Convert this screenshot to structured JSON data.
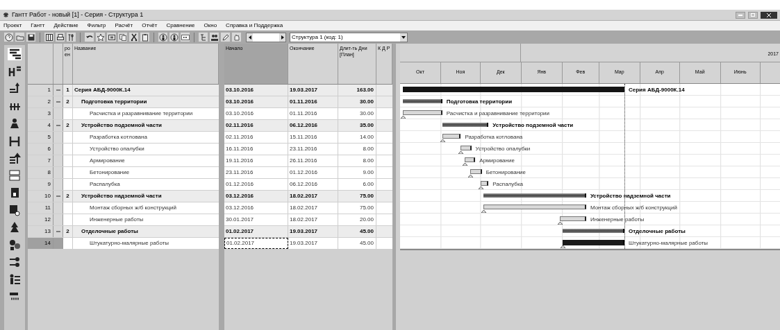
{
  "window": {
    "title": "Гантт Работ - новый [1] - Серия - Структура 1"
  },
  "menu": [
    "Проект",
    "Гантт",
    "Действие",
    "Фильтр",
    "Расчёт",
    "Отчёт",
    "Сравнение",
    "Окно",
    "Справка и Поддержка"
  ],
  "toolbar": {
    "structure_select": {
      "value": "Структура 1 (код: 1)"
    }
  },
  "table": {
    "columns": [
      {
        "label": "ро ен",
        "selected": false
      },
      {
        "label": "Название",
        "selected": false
      },
      {
        "label": "Начало",
        "selected": true
      },
      {
        "label": "Окончание",
        "selected": false
      },
      {
        "label": "Длит-ть Дни [План]",
        "selected": false
      },
      {
        "label": "К Д Р",
        "selected": false
      }
    ],
    "rows": [
      {
        "number": "1",
        "expanded": true,
        "level": "1",
        "name": "Серия АБД-9000К.14",
        "start": "03.10.2016",
        "end": "19.03.2017",
        "duration": "163.00",
        "kind": "root",
        "selected": false,
        "bar_label": "Серия АБД-9000К.14"
      },
      {
        "number": "2",
        "expanded": true,
        "level": "2",
        "name": "Подготовка территории",
        "start": "03.10.2016",
        "end": "01.11.2016",
        "duration": "30.00",
        "kind": "summary",
        "selected": false,
        "bar_label": "Подготовка территории"
      },
      {
        "number": "3",
        "name": "Расчистка и разравнивание территории",
        "start": "03.10.2016",
        "end": "01.11.2016",
        "duration": "30.00",
        "kind": "task",
        "selected": false,
        "bar_label": "Расчистка и разравнивание территории"
      },
      {
        "number": "4",
        "expanded": true,
        "level": "2",
        "name": "Устройство подземной части",
        "start": "02.11.2016",
        "end": "06.12.2016",
        "duration": "35.00",
        "kind": "summary",
        "selected": false,
        "bar_label": "Устройство подземной части"
      },
      {
        "number": "5",
        "name": "Разработка котлована",
        "start": "02.11.2016",
        "end": "15.11.2016",
        "duration": "14.00",
        "kind": "task",
        "selected": false,
        "bar_label": "Разработка котлована"
      },
      {
        "number": "6",
        "name": "Устройство опалубки",
        "start": "16.11.2016",
        "end": "23.11.2016",
        "duration": "8.00",
        "kind": "task",
        "selected": false,
        "bar_label": "Устройство опалубки"
      },
      {
        "number": "7",
        "name": "Армирование",
        "start": "19.11.2016",
        "end": "26.11.2016",
        "duration": "8.00",
        "kind": "task",
        "selected": false,
        "bar_label": "Армирование"
      },
      {
        "number": "8",
        "name": "Бетонирование",
        "start": "23.11.2016",
        "end": "01.12.2016",
        "duration": "9.00",
        "kind": "task",
        "selected": false,
        "bar_label": "Бетонирование"
      },
      {
        "number": "9",
        "name": "Распалубка",
        "start": "01.12.2016",
        "end": "06.12.2016",
        "duration": "6.00",
        "kind": "task",
        "selected": false,
        "bar_label": "Распалубка"
      },
      {
        "number": "10",
        "expanded": true,
        "level": "2",
        "name": "Устройство надземной части",
        "start": "03.12.2016",
        "end": "18.02.2017",
        "duration": "75.00",
        "kind": "summary",
        "selected": false,
        "bar_label": "Устройство надземной части"
      },
      {
        "number": "11",
        "name": "Монтаж сборных ж/б конструкций",
        "start": "03.12.2016",
        "end": "18.02.2017",
        "duration": "75.00",
        "kind": "task",
        "selected": false,
        "bar_label": "Монтаж сборных ж/б конструкций"
      },
      {
        "number": "12",
        "name": "Инженерные работы",
        "start": "30.01.2017",
        "end": "18.02.2017",
        "duration": "20.00",
        "kind": "task",
        "selected": false,
        "bar_label": "Инженерные работы"
      },
      {
        "number": "13",
        "expanded": true,
        "level": "2",
        "name": "Отделочные работы",
        "start": "01.02.2017",
        "end": "19.03.2017",
        "duration": "45.00",
        "kind": "summary",
        "selected": false,
        "bar_label": "Отделочные работы"
      },
      {
        "number": "14",
        "name": "Штукатурно-малярные работы",
        "start": "01.02.2017",
        "end": "19.03.2017",
        "duration": "45.00",
        "kind": "critical",
        "selected": true,
        "bar_label": "Штукатурно-малярные работы"
      }
    ]
  },
  "timeline": {
    "year": "2017",
    "months": [
      "Окт",
      "Ноя",
      "Дек",
      "Янв",
      "Фев",
      "Мар",
      "Апр",
      "Май",
      "Июнь"
    ]
  }
}
